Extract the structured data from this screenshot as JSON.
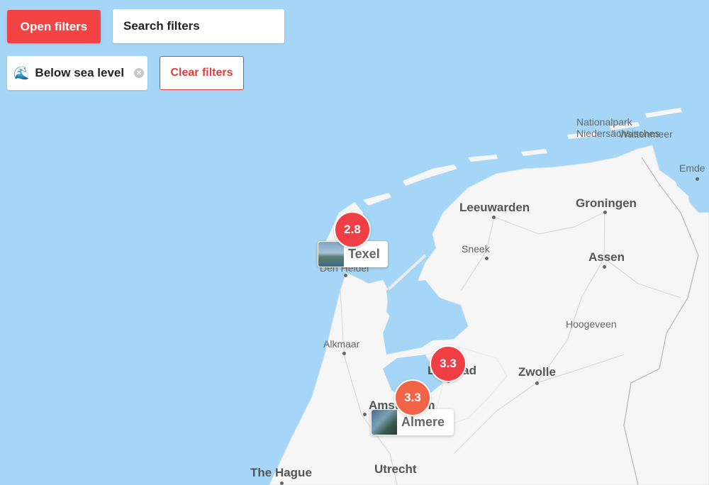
{
  "toolbar": {
    "open_filters_label": "Open filters",
    "search_placeholder": "Search filters",
    "active_filter": {
      "emoji": "🌊",
      "label": "Below sea level",
      "remove_icon": "close-circle-icon"
    },
    "clear_filters_label": "Clear filters"
  },
  "colors": {
    "sea": "#a6d6f7",
    "land": "#f6f6f6",
    "accent": "#f24444",
    "badge_red": "#ef3f45",
    "badge_orange": "#f26448"
  },
  "map": {
    "places": [
      {
        "name": "Leeuwarden"
      },
      {
        "name": "Groningen"
      },
      {
        "name": "Sneek"
      },
      {
        "name": "Assen"
      },
      {
        "name": "Hoogeveen"
      },
      {
        "name": "Alkmaar"
      },
      {
        "name": "Zwolle"
      },
      {
        "name": "Amsterdam"
      },
      {
        "name": "Utrecht"
      },
      {
        "name": "The Hague"
      },
      {
        "name": "Den Helder"
      },
      {
        "name": "Lelystad"
      },
      {
        "name": "Emde"
      },
      {
        "name": "Nationalpark Niedersächsisches"
      },
      {
        "name": "Wattenmeer"
      }
    ],
    "markers": [
      {
        "name": "Texel",
        "score": "2.8",
        "color": "#ef3f45"
      },
      {
        "name": "Almere",
        "score": "3.3",
        "color": "#f26448"
      }
    ],
    "clusters": [
      {
        "score": "3.3",
        "color": "#ef3f45"
      }
    ]
  }
}
